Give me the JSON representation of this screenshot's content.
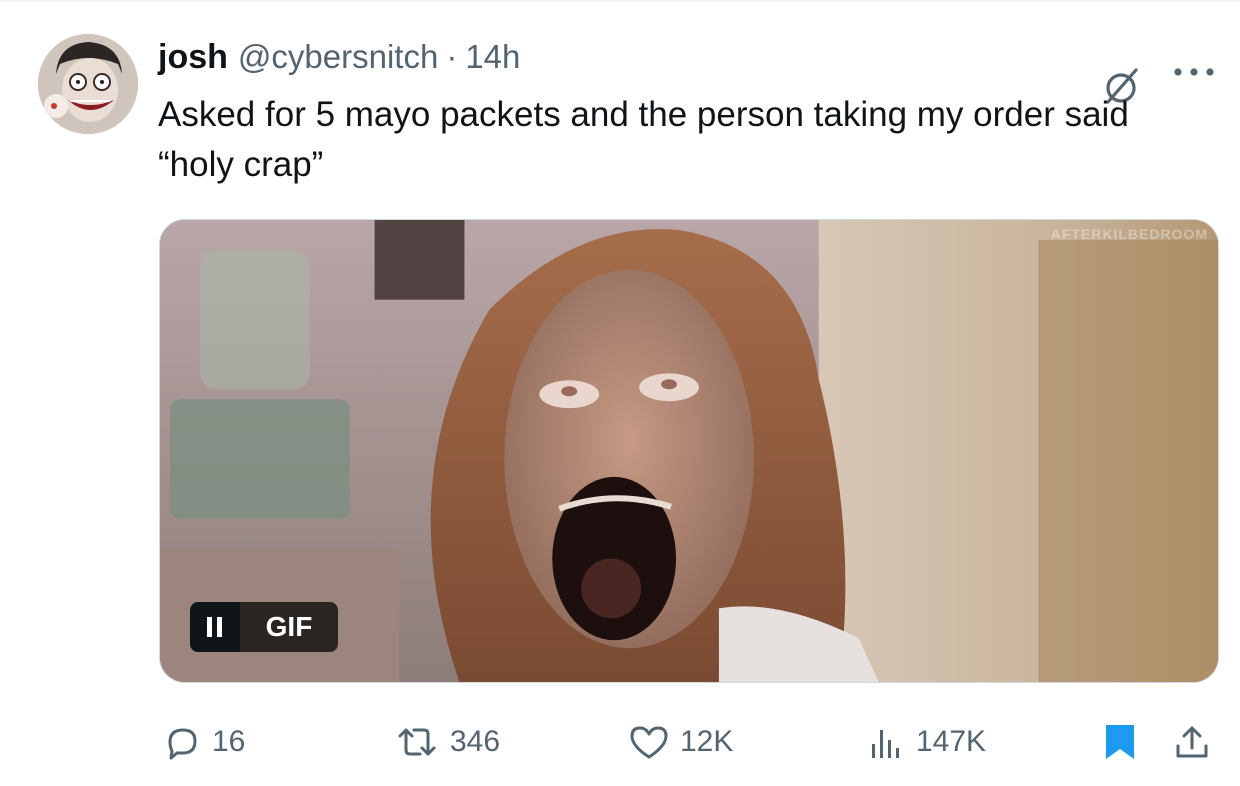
{
  "author": {
    "name": "josh",
    "handle": "@cybersnitch",
    "separator": "·",
    "time": "14h"
  },
  "tweet": {
    "text": "Asked for 5 mayo packets and the person taking my order said “holy crap”"
  },
  "media": {
    "type": "GIF",
    "badge_label": "GIF",
    "watermark": "AFTERKILBEDROOM"
  },
  "actions": {
    "replies": "16",
    "reposts": "346",
    "likes": "12K",
    "views": "147K"
  },
  "icons": {
    "reply": "reply-icon",
    "repost": "repost-icon",
    "like": "heart-icon",
    "views": "views-chart-icon",
    "bookmark": "bookmark-icon",
    "share": "share-icon",
    "grok": "grok-icon",
    "more": "more-icon"
  },
  "colors": {
    "text": "#0f1419",
    "secondary": "#536471",
    "bookmark_active": "#1d9bf0",
    "border": "#cfd9de"
  }
}
